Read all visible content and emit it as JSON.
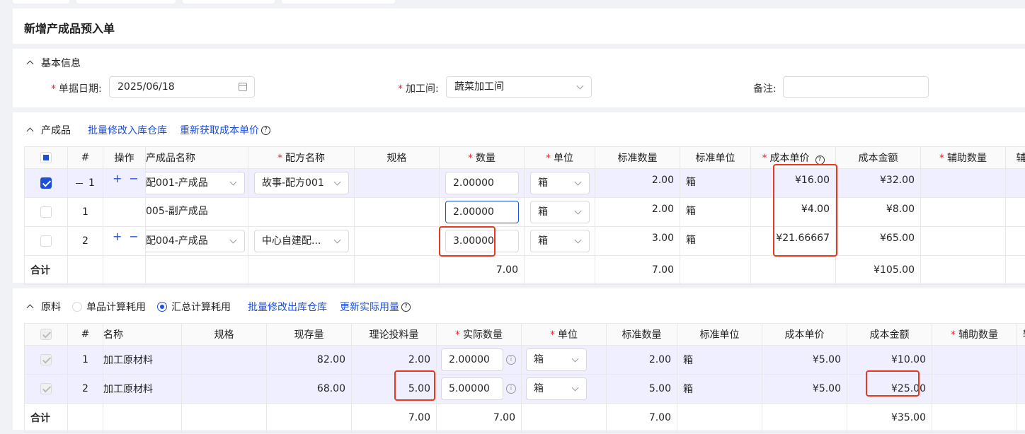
{
  "page": {
    "title": "新增产成品预入单"
  },
  "basic": {
    "section_title": "基本信息",
    "date_label": "单据日期:",
    "date_value": "2025/06/18",
    "workshop_label": "加工间:",
    "workshop_value": "蔬菜加工间",
    "remark_label": "备注:",
    "remark_value": ""
  },
  "products": {
    "section_title": "产成品",
    "link_batch": "批量修改入库仓库",
    "link_refetch": "重新获取成本单价",
    "help": "?",
    "headers": [
      "#",
      "操作",
      "产成品名称",
      "配方名称",
      "规格",
      "数量",
      "单位",
      "标准数量",
      "标准单位",
      "成本单价",
      "成本金额",
      "辅助数量",
      "辅"
    ],
    "rows": [
      {
        "idx": "1",
        "name": "配001-产成品",
        "recipe": "故事-配方001",
        "spec": "",
        "qty": "2.00000",
        "unit": "箱",
        "std_qty": "2.00",
        "std_unit": "箱",
        "unit_cost": "¥16.00",
        "amount": "¥32.00"
      },
      {
        "idx": "1",
        "name": "005-副产成品",
        "recipe": "",
        "spec": "",
        "qty": "2.00000",
        "unit": "箱",
        "std_qty": "2.00",
        "std_unit": "箱",
        "unit_cost": "¥4.00",
        "amount": "¥8.00"
      },
      {
        "idx": "2",
        "name": "配004-产成品",
        "recipe": "中心自建配...",
        "spec": "",
        "qty": "3.00000",
        "unit": "箱",
        "std_qty": "3.00",
        "std_unit": "箱",
        "unit_cost": "¥21.66667",
        "amount": "¥65.00"
      }
    ],
    "total": {
      "label": "合计",
      "qty": "7.00",
      "std_qty": "7.00",
      "amount": "¥105.00"
    }
  },
  "materials": {
    "section_title": "原料",
    "radio_single": "单品计算耗用",
    "radio_total": "汇总计算耗用",
    "link_batch": "批量修改出库仓库",
    "link_update": "更新实际用量",
    "help": "?",
    "headers": [
      "#",
      "名称",
      "规格",
      "现存量",
      "理论投料量",
      "实际数量",
      "单位",
      "标准数量",
      "标准单位",
      "成本单价",
      "成本金额",
      "辅助数量",
      "辅"
    ],
    "rows": [
      {
        "idx": "1",
        "name": "加工原材料",
        "spec": "",
        "stock": "82.00",
        "theory": "2.00",
        "actual": "2.00000",
        "unit": "箱",
        "std_qty": "2.00",
        "std_unit": "箱",
        "unit_cost": "¥5.00",
        "amount": "¥10.00"
      },
      {
        "idx": "2",
        "name": "加工原材料",
        "spec": "",
        "stock": "68.00",
        "theory": "5.00",
        "actual": "5.00000",
        "unit": "箱",
        "std_qty": "5.00",
        "std_unit": "箱",
        "unit_cost": "¥5.00",
        "amount": "¥25.00"
      }
    ],
    "total": {
      "label": "合计",
      "theory": "7.00",
      "actual": "7.00",
      "std_qty": "7.00",
      "amount": "¥35.00"
    }
  },
  "glyphs": {
    "plus": "+",
    "minus": "−",
    "info": "i"
  }
}
